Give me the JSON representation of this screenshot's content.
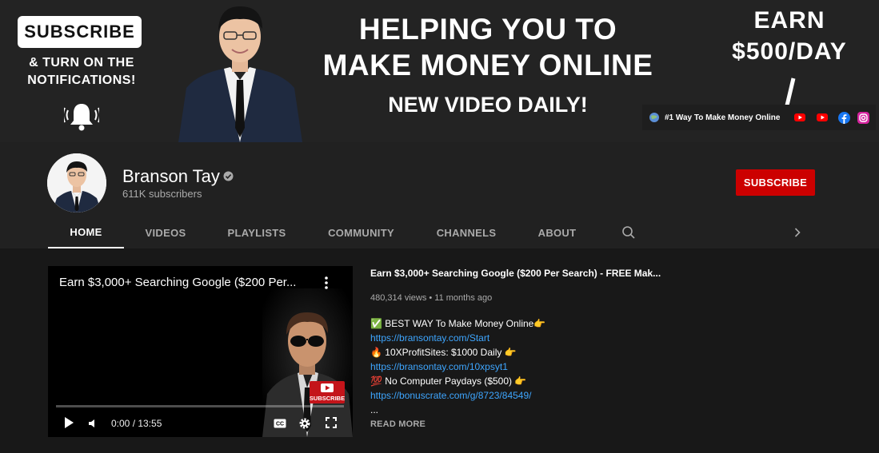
{
  "banner": {
    "subscribe_box": "SUBSCRIBE",
    "turn_on_line1": "& TURN ON THE",
    "turn_on_line2": "NOTIFICATIONS!",
    "headline_line1": "HELPING YOU TO",
    "headline_line2": "MAKE MONEY ONLINE",
    "daily": "NEW VIDEO DAILY!",
    "earn_line1": "EARN",
    "earn_line2": "$500/DAY",
    "link_text": "#1 Way To Make Money Online",
    "social_icons": [
      "youtube-icon",
      "youtube-icon",
      "facebook-icon",
      "instagram-icon"
    ]
  },
  "channel": {
    "name": "Branson Tay",
    "subscribers": "611K subscribers",
    "subscribe_label": "SUBSCRIBE"
  },
  "tabs": [
    {
      "label": "HOME",
      "active": true
    },
    {
      "label": "VIDEOS"
    },
    {
      "label": "PLAYLISTS"
    },
    {
      "label": "COMMUNITY"
    },
    {
      "label": "CHANNELS"
    },
    {
      "label": "ABOUT"
    }
  ],
  "player": {
    "title": "Earn $3,000+ Searching Google ($200 Per...",
    "time": "0:00 / 13:55",
    "sub_logo_text": "SUBSCRIBE",
    "progress": 0
  },
  "video": {
    "title": "Earn $3,000+ Searching Google ($200 Per Search) - FREE Mak...",
    "meta": "480,314 views • 11 months ago",
    "desc": [
      "✅ BEST WAY To Make Money Online👉",
      "https://bransontay.com/Start",
      "🔥 10XProfitSites: $1000 Daily 👉",
      "https://bransontay.com/10xpsyt1",
      "💯 No Computer Paydays ($500) 👉",
      "https://bonuscrate.com/g/8723/84549/",
      "..."
    ],
    "read_more": "READ MORE"
  },
  "colors": {
    "subscribe_red": "#cc0000",
    "link_blue": "#3ea6ff",
    "bg_dark": "#181818",
    "header_bg": "#212121"
  }
}
